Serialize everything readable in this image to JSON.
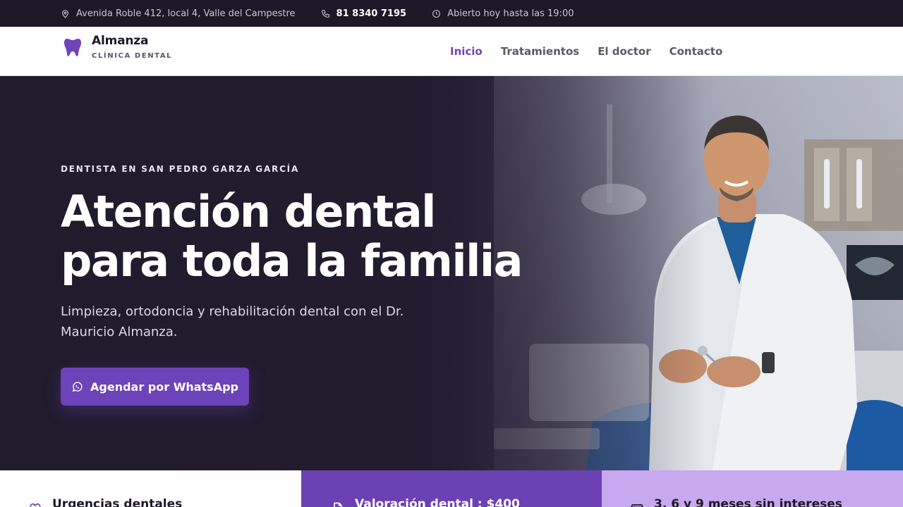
{
  "topbar": {
    "address": "Avenida Roble 412, local 4, Valle del Campestre",
    "phone": "81 8340 7195",
    "hours": "Abierto hoy hasta las 19:00",
    "icons": [
      "map-pin-icon",
      "phone-icon",
      "clock-icon"
    ]
  },
  "brand": {
    "name": "Almanza",
    "subtitle": "CLÍNICA DENTAL",
    "icon": "tooth-icon",
    "color": "#6f43b9"
  },
  "nav": {
    "items": [
      {
        "label": "Inicio",
        "active": true
      },
      {
        "label": "Tratamientos",
        "active": false
      },
      {
        "label": "El doctor",
        "active": false
      },
      {
        "label": "Contacto",
        "active": false
      }
    ]
  },
  "hero": {
    "eyebrow": "DENTISTA EN SAN PEDRO GARZA GARCÍA",
    "headline_line1": "Atención dental",
    "headline_line2": "para toda la familia",
    "lead": "Limpieza, ortodoncia y rehabilitación dental con el Dr. Mauricio Almanza.",
    "cta_label": "Agendar por WhatsApp",
    "cta_icon": "whatsapp-icon",
    "cta_color": "#6c43b8"
  },
  "features": [
    {
      "label": "Urgencias dentales",
      "icon": "heart-tooth-icon"
    },
    {
      "label": "Valoración dental : $400",
      "icon": "document-icon"
    },
    {
      "label": "3, 6 y 9 meses sin intereses",
      "icon": "card-icon"
    }
  ]
}
